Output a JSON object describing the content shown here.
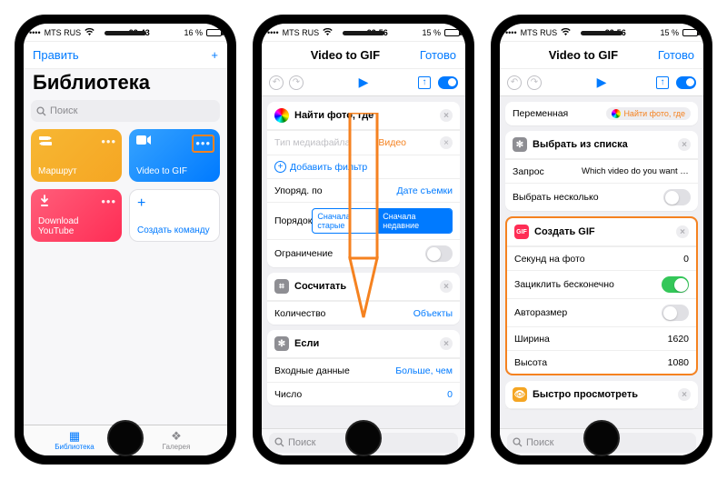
{
  "phones": {
    "p1": {
      "status": {
        "carrier": "MTS RUS",
        "signal": "▪▪▪▪",
        "wifi": "⦿",
        "time": "22:43",
        "battery_pct": "16 %"
      },
      "nav": {
        "edit": "Править",
        "title": "Библиотека"
      },
      "search_placeholder": "Поиск",
      "cards": {
        "c1": {
          "label": "Маршрут",
          "color": "#f5a623",
          "icon": "signpost"
        },
        "c2": {
          "label": "Video to GIF",
          "color": "#007aff",
          "icon": "video"
        },
        "c3": {
          "label": "Download YouTube",
          "color": "#ff2d55",
          "icon": "download"
        },
        "c4": {
          "label": "Создать команду"
        }
      },
      "tabs": {
        "library": "Библиотека",
        "gallery": "Галерея"
      }
    },
    "p2": {
      "status": {
        "carrier": "MTS RUS",
        "time": "22:56",
        "battery_pct": "15 %"
      },
      "nav": {
        "title": "Video to GIF",
        "done": "Готово"
      },
      "blocks": {
        "find": {
          "title": "Найти фото, где",
          "media_type": "Тип медиафайла",
          "media_val": "Видео",
          "add_filter": "Добавить фильтр",
          "order_by": "Упоряд. по",
          "order_by_val": "Дате съемки",
          "order": "Порядок",
          "seg_old": "Сначала старые",
          "seg_new": "Сначала недавние",
          "limit": "Ограничение"
        },
        "count": {
          "title": "Сосчитать",
          "qty": "Количество",
          "qty_val": "Объекты"
        },
        "if": {
          "title": "Если",
          "input": "Входные данные",
          "input_val": "Больше, чем",
          "number": "Число",
          "number_val": "0"
        }
      },
      "search_placeholder": "Поиск"
    },
    "p3": {
      "status": {
        "carrier": "MTS RUS",
        "time": "22:56",
        "battery_pct": "15 %"
      },
      "nav": {
        "title": "Video to GIF",
        "done": "Готово"
      },
      "blocks": {
        "var": {
          "label": "Переменная",
          "val": "Найти фото, где"
        },
        "choose": {
          "title": "Выбрать из списка",
          "prompt": "Запрос",
          "prompt_val": "Which video do you want to make a...",
          "multi": "Выбрать несколько"
        },
        "gif": {
          "title": "Создать GIF",
          "spp": "Секунд на фото",
          "spp_val": "0",
          "loop": "Зациклить бесконечно",
          "autosize": "Авторазмер",
          "width": "Ширина",
          "width_val": "1620",
          "height": "Высота",
          "height_val": "1080"
        },
        "quick": {
          "title": "Быстро просмотреть"
        }
      },
      "search_placeholder": "Поиск"
    }
  }
}
